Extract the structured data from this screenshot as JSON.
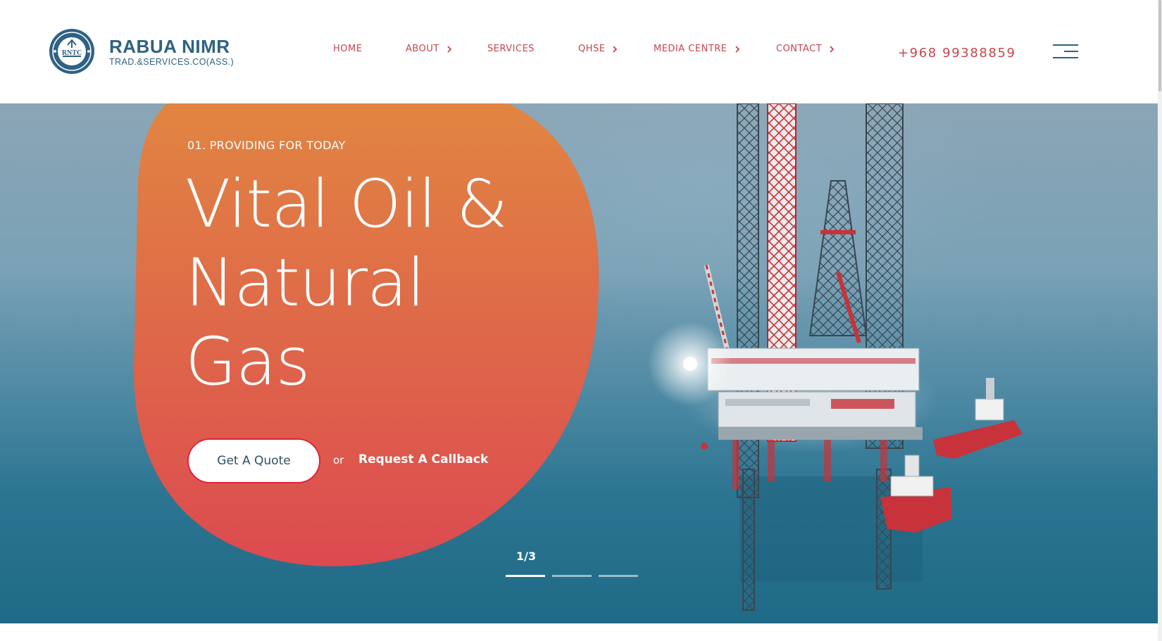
{
  "brand": {
    "name": "RABUA NIMR",
    "subtitle": "TRAD.&SERVICES.CO(ASS.)",
    "emblem_text": "RNTC",
    "color": "#2e6283"
  },
  "nav": {
    "items": [
      {
        "label": "HOME",
        "has_submenu": false
      },
      {
        "label": "ABOUT",
        "has_submenu": true
      },
      {
        "label": "SERVICES",
        "has_submenu": false
      },
      {
        "label": "QHSE",
        "has_submenu": true
      },
      {
        "label": "MEDIA CENTRE",
        "has_submenu": true
      },
      {
        "label": "CONTACT",
        "has_submenu": true
      }
    ],
    "phone": "+968 99388859",
    "color": "#c7464f"
  },
  "hero": {
    "kicker": "01. PROVIDING FOR TODAY",
    "headline_lines": [
      "Vital Oil &",
      "Natural",
      "Gas"
    ],
    "cta_primary": "Get A Quote",
    "cta_or": "or",
    "cta_secondary": "Request A Callback",
    "slide_counter": "1/3",
    "slides_total": 3,
    "active_slide": 1,
    "accent_gradient": [
      "#e18542",
      "#dc4a50"
    ]
  }
}
